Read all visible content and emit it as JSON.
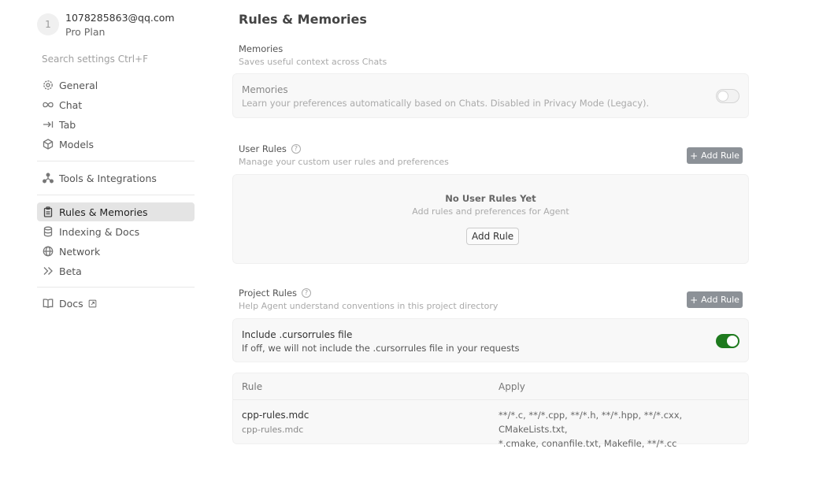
{
  "user": {
    "avatar": "1",
    "email": "1078285863@qq.com",
    "plan": "Pro Plan"
  },
  "search": {
    "placeholder": "Search settings Ctrl+F"
  },
  "nav": {
    "general": "General",
    "chat": "Chat",
    "tab": "Tab",
    "models": "Models",
    "tools": "Tools & Integrations",
    "rules": "Rules & Memories",
    "indexing": "Indexing & Docs",
    "network": "Network",
    "beta": "Beta",
    "docs": "Docs"
  },
  "page": {
    "title": "Rules & Memories"
  },
  "memories": {
    "section_title": "Memories",
    "section_desc": "Saves useful context across Chats",
    "card_title": "Memories",
    "card_desc": "Learn your preferences automatically based on Chats. Disabled in Privacy Mode (Legacy).",
    "enabled": false
  },
  "user_rules": {
    "section_title": "User Rules",
    "section_desc": "Manage your custom user rules and preferences",
    "add_button": "Add Rule",
    "empty_title": "No User Rules Yet",
    "empty_desc": "Add rules and preferences for Agent",
    "empty_button": "Add Rule"
  },
  "project_rules": {
    "section_title": "Project Rules",
    "section_desc": "Help Agent understand conventions in this project directory",
    "add_button": "Add Rule",
    "cursorrules_title": "Include .cursorrules file",
    "cursorrules_desc": "If off, we will not include the .cursorrules file in your requests",
    "cursorrules_enabled": true,
    "colors": {
      "toggle_on": "#1e7a1e",
      "button_bg": "#8c9197"
    },
    "table": {
      "col_rule": "Rule",
      "col_apply": "Apply",
      "rows": [
        {
          "name": "cpp-rules.mdc",
          "file": "cpp-rules.mdc",
          "apply_line1": "**/*.c, **/*.cpp, **/*.h, **/*.hpp, **/*.cxx, CMakeLists.txt,",
          "apply_line2": "*.cmake, conanfile.txt, Makefile, **/*.cc"
        }
      ]
    }
  }
}
